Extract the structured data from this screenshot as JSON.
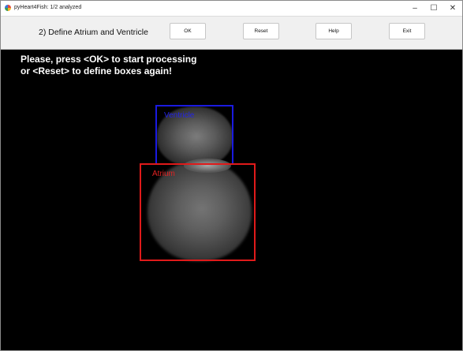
{
  "window": {
    "title": "pyHeart4Fish: 1/2 analyzed",
    "controls": {
      "minimize": "–",
      "maximize": "☐",
      "close": "✕"
    }
  },
  "toolbar": {
    "step_label": "2) Define Atrium and Ventricle",
    "ok_label": "OK",
    "reset_label": "Reset",
    "help_label": "Help",
    "exit_label": "Exit"
  },
  "canvas": {
    "instruction_line1": "Please, press <OK> to start processing",
    "instruction_line2": "or <Reset> to define boxes again!",
    "ventricle_label": "Ventricle",
    "atrium_label": "Atrium",
    "colors": {
      "ventricle": "#1a1ae0",
      "atrium": "#e01a1a",
      "background": "#000000"
    }
  }
}
